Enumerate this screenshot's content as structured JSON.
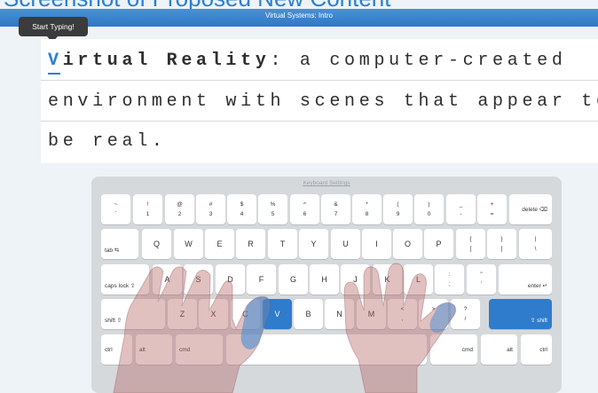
{
  "page": {
    "caption": "Screenshot of Proposed New Content"
  },
  "header": {
    "title": "Virtual Systems: Intro"
  },
  "tooltip": {
    "text": "Start Typing!"
  },
  "lesson": {
    "current_char": "V",
    "line1_bold": "irtual Reality",
    "line1_rest": ": a computer-created",
    "line2": "environment with scenes that appear to",
    "line3": "be real."
  },
  "keyboard": {
    "settings_label": "Keyboard Settings",
    "row1": [
      {
        "up": "~",
        "dn": "`"
      },
      {
        "up": "!",
        "dn": "1"
      },
      {
        "up": "@",
        "dn": "2"
      },
      {
        "up": "#",
        "dn": "3"
      },
      {
        "up": "$",
        "dn": "4"
      },
      {
        "up": "%",
        "dn": "5"
      },
      {
        "up": "^",
        "dn": "6"
      },
      {
        "up": "&",
        "dn": "7"
      },
      {
        "up": "*",
        "dn": "8"
      },
      {
        "up": "(",
        "dn": "9"
      },
      {
        "up": ")",
        "dn": "0"
      },
      {
        "up": "_",
        "dn": "-"
      },
      {
        "up": "+",
        "dn": "="
      }
    ],
    "delete_label": "delete ⌫",
    "tab_label": "tab ⇆",
    "row2": [
      "Q",
      "W",
      "E",
      "R",
      "T",
      "Y",
      "U",
      "I",
      "O",
      "P"
    ],
    "row2_sym": [
      {
        "up": "{",
        "dn": "["
      },
      {
        "up": "}",
        "dn": "]"
      },
      {
        "up": "|",
        "dn": "\\"
      }
    ],
    "capslock_label": "caps lock ⇪",
    "row3": [
      "A",
      "S",
      "D",
      "F",
      "G",
      "H",
      "J",
      "K",
      "L"
    ],
    "row3_sym": [
      {
        "up": ":",
        "dn": ";"
      },
      {
        "up": "\"",
        "dn": "'"
      }
    ],
    "enter_label": "enter ↵",
    "shift_left_label": "shift ⇧",
    "row4": [
      "Z",
      "X",
      "C",
      "V",
      "B",
      "N",
      "M"
    ],
    "row4_sym": [
      {
        "up": "<",
        "dn": ","
      },
      {
        "up": ">",
        "dn": "."
      },
      {
        "up": "?",
        "dn": "/"
      }
    ],
    "shift_right_label": "⇧ shift",
    "bottom": {
      "ctrl_l": "ctrl",
      "alt_l": "alt",
      "cmd_l": "cmd",
      "cmd_r": "cmd",
      "alt_r": "alt",
      "ctrl_r": "ctrl"
    },
    "highlight_color": "#2f7ccc",
    "highlighted_keys": [
      "V",
      "shift-right"
    ]
  }
}
